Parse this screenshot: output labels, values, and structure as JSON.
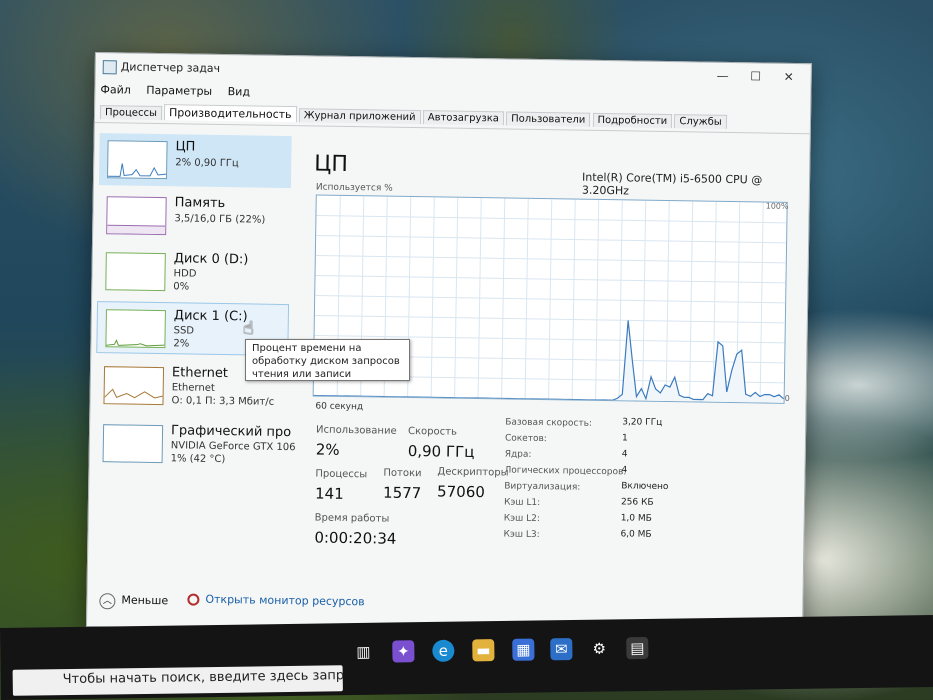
{
  "window": {
    "title": "Диспетчер задач",
    "controls": {
      "minimize": "—",
      "maximize": "☐",
      "close": "✕"
    }
  },
  "menu": [
    "Файл",
    "Параметры",
    "Вид"
  ],
  "tabs": [
    "Процессы",
    "Производительность",
    "Журнал приложений",
    "Автозагрузка",
    "Пользователи",
    "Подробности",
    "Службы"
  ],
  "active_tab": "Производительность",
  "sidebar": {
    "items": [
      {
        "name": "ЦП",
        "line1": "2% 0,90 ГГц",
        "line2": "",
        "icon": "cpu-graph-icon"
      },
      {
        "name": "Память",
        "line1": "3,5/16,0 ГБ (22%)",
        "line2": "",
        "icon": "memory-graph-icon"
      },
      {
        "name": "Диск 0 (D:)",
        "line1": "HDD",
        "line2": "0%",
        "icon": "disk-graph-icon"
      },
      {
        "name": "Диск 1 (C:)",
        "line1": "SSD",
        "line2": "2%",
        "icon": "disk-graph-icon"
      },
      {
        "name": "Ethernet",
        "line1": "Ethernet",
        "line2": "О: 0,1 П: 3,3 Мбит/с",
        "icon": "network-graph-icon"
      },
      {
        "name": "Графический про",
        "line1": "NVIDIA GeForce GTX 106",
        "line2": "1% (42 °C)",
        "icon": "gpu-graph-icon"
      }
    ]
  },
  "main": {
    "title": "ЦП",
    "cpu_model": "Intel(R) Core(TM) i5-6500 CPU @ 3.20GHz",
    "graph_label": "Используется %",
    "graph_max_label": "100%",
    "graph_min_label": "0",
    "time_label": "60 секунд",
    "stats": {
      "utilization_label": "Использование",
      "utilization": "2%",
      "speed_label": "Скорость",
      "speed": "0,90 ГГц",
      "processes_label": "Процессы",
      "processes": "141",
      "threads_label": "Потоки",
      "threads": "1577",
      "handles_label": "Дескрипторы",
      "handles": "57060",
      "uptime_label": "Время работы",
      "uptime": "0:00:20:34"
    },
    "details": [
      {
        "label": "Базовая скорость:",
        "value": "3,20 ГГц"
      },
      {
        "label": "Сокетов:",
        "value": "1"
      },
      {
        "label": "Ядра:",
        "value": "4"
      },
      {
        "label": "Логических процессоров:",
        "value": "4"
      },
      {
        "label": "Виртуализация:",
        "value": "Включено"
      },
      {
        "label": "Кэш L1:",
        "value": "256 КБ"
      },
      {
        "label": "Кэш L2:",
        "value": "1,0 МБ"
      },
      {
        "label": "Кэш L3:",
        "value": "6,0 МБ"
      }
    ]
  },
  "tooltip": "Процент времени на обработку диском запросов чтения или записи",
  "footer": {
    "less": "Меньше",
    "monitor": "Открыть монитор ресурсов"
  },
  "taskbar": {
    "search_placeholder": "Чтобы начать поиск, введите здесь запрос"
  },
  "cpu_history_percent": [
    0,
    0,
    0,
    0,
    0,
    0,
    0,
    0,
    0,
    0,
    0,
    0,
    0,
    0,
    0,
    0,
    0,
    0,
    0,
    0,
    0,
    0,
    0,
    0,
    0,
    0,
    0,
    0,
    0,
    0,
    0,
    0,
    0,
    0,
    0,
    0,
    0,
    0,
    0,
    0,
    0,
    0,
    0,
    0,
    0,
    0,
    0,
    0,
    0,
    0,
    0,
    0,
    0,
    0,
    0,
    0,
    0,
    0,
    0,
    0,
    0,
    0,
    0,
    0,
    1,
    3,
    40,
    20,
    2,
    6,
    1,
    12,
    6,
    4,
    8,
    7,
    12,
    3,
    2,
    2,
    1,
    1,
    1,
    4,
    3,
    30,
    28,
    5,
    16,
    24,
    26,
    4,
    3,
    5,
    3,
    4,
    4,
    3,
    4,
    2
  ]
}
